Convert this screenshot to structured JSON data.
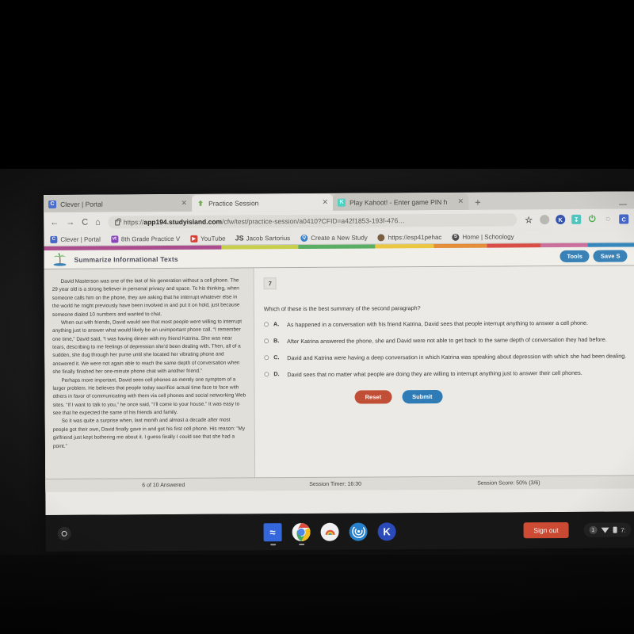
{
  "browser": {
    "tabs": [
      {
        "title": "Clever | Portal",
        "favicon": "clever-icon",
        "active": false,
        "close_label": "✕"
      },
      {
        "title": "Practice Session",
        "favicon": "studyisland-icon",
        "active": true,
        "close_label": "✕"
      },
      {
        "title": "Play Kahoot! - Enter game PIN h",
        "favicon": "kahoot-icon",
        "active": false,
        "close_label": "✕"
      }
    ],
    "new_tab_label": "+",
    "nav": {
      "back": "←",
      "forward": "→",
      "reload": "C",
      "home": "⌂"
    },
    "omnibox": {
      "url_prefix": "https://",
      "url_domain": "app194.studyisland.com",
      "url_path": "/cfw/test/practice-session/a0410?CFID=a42f1853-193f-476…"
    },
    "omnibox_icons": [
      "star-icon",
      "extension-gray-icon",
      "kahoot-extension-icon",
      "teal-extension-icon",
      "power-extension-icon",
      "circle-extension-icon",
      "clever-extension-icon"
    ],
    "bookmarks": [
      {
        "label": "Clever | Portal",
        "icon": "clever-bookmark-icon"
      },
      {
        "label": "8th Grade Practice V",
        "icon": "vt-bookmark-icon"
      },
      {
        "label": "YouTube",
        "icon": "youtube-bookmark-icon"
      },
      {
        "label": "Jacob Sartorius",
        "icon": "js-bookmark-icon"
      },
      {
        "label": "Create a New Study",
        "icon": "quizlet-bookmark-icon"
      },
      {
        "label": "https://esp41pehac",
        "icon": "esp-bookmark-icon"
      },
      {
        "label": "Home | Schoology",
        "icon": "schoology-bookmark-icon"
      }
    ]
  },
  "studyisland": {
    "stripe_colors": [
      "#b0458f",
      "#c8d13c",
      "#4fb05a",
      "#f0c830",
      "#ef8a2a",
      "#e5453c",
      "#d46a9e",
      "#2b86c4"
    ],
    "header": {
      "title": "Summarize Informational Texts",
      "tools_label": "Tools",
      "save_label": "Save S"
    },
    "passage": {
      "paragraphs": [
        "David Masterson was one of the last of his generation without a cell phone. The 29 year old is a strong believer in personal privacy and space. To his thinking, when someone calls him on the phone, they are asking that he interrupt whatever else in the world he might previously have been involved in and put it on hold, just because someone dialed 10 numbers and wanted to chat.",
        "When out with friends, David would see that most people were willing to interrupt anything just to answer what would likely be an unimportant phone call. “I remember one time,” David said, “I was having dinner with my friend Katrina. She was near tears, describing to me feelings of depression she’d been dealing with. Then, all of a sudden, she dug through her purse until she located her vibrating phone and answered it. We were not again able to reach the same depth of conversation when she finally finished her one-minute phone chat with another friend.”",
        "Perhaps more important, David sees cell phones as merely one symptom of a larger problem. He believes that people today sacrifice actual time face to face with others in favor of communicating with them via cell phones and social networking Web sites. “If I want to talk to you,” he once said, “I’ll come to your house.” It was easy to see that he expected the same of his friends and family.",
        "So it was quite a surprise when, last month and almost a decade after most people got their own, David finally gave in and got his first cell phone. His reason: “My girlfriend just kept bothering me about it. I guess finally I could see that she had a point.”"
      ]
    },
    "question": {
      "number": "7",
      "prompt": "Which of these is the best summary of the second paragraph?",
      "choices": [
        {
          "letter": "A.",
          "text": "As happened in a conversation with his friend Katrina, David sees that people interrupt anything to answer a cell phone."
        },
        {
          "letter": "B.",
          "text": "After Katrina answered the phone, she and David were not able to get back to the same depth of conversation they had before."
        },
        {
          "letter": "C.",
          "text": "David and Katrina were having a deep conversation in which Katrina was speaking about depression with which she had been dealing."
        },
        {
          "letter": "D.",
          "text": "David sees that no matter what people are doing they are willing to interrupt anything just to answer their cell phones."
        }
      ]
    },
    "actions": {
      "reset_label": "Reset",
      "submit_label": "Submit"
    },
    "footer": {
      "answered": "6 of 10 Answered",
      "timer": "Session Timer: 16:30",
      "score": "Session Score: 50% (3/6)"
    }
  },
  "shelf": {
    "launcher_name": "launcher-icon",
    "apps": [
      {
        "name": "wave-app-icon",
        "glyph": "≈"
      },
      {
        "name": "chrome-icon",
        "glyph": ""
      },
      {
        "name": "rainbow-app-icon",
        "glyph": ""
      },
      {
        "name": "blue-target-app-icon",
        "glyph": "◎"
      },
      {
        "name": "kahoot-app-icon",
        "glyph": "K"
      }
    ],
    "sign_out_label": "Sign out",
    "tray": {
      "badge": "1",
      "time": "7:"
    }
  }
}
